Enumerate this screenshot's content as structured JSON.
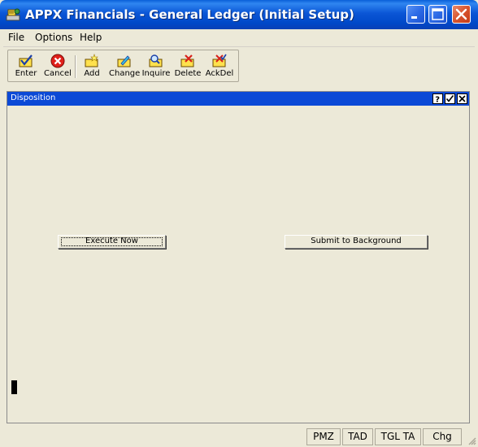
{
  "window": {
    "title": "APPX Financials - General Ledger (Initial Setup)",
    "icon": "appx-app-icon"
  },
  "menu": {
    "items": [
      {
        "label": "File"
      },
      {
        "label": "Options"
      },
      {
        "label": "Help"
      }
    ]
  },
  "toolbar": {
    "buttons": [
      {
        "label": "Enter",
        "icon": "enter-icon"
      },
      {
        "label": "Cancel",
        "icon": "cancel-icon"
      },
      {
        "label": "Add",
        "icon": "add-icon"
      },
      {
        "label": "Change",
        "icon": "change-icon"
      },
      {
        "label": "Inquire",
        "icon": "inquire-icon"
      },
      {
        "label": "Delete",
        "icon": "delete-icon"
      },
      {
        "label": "AckDel",
        "icon": "ackdel-icon"
      }
    ]
  },
  "pane": {
    "title": "Disposition",
    "header_buttons": [
      "help-icon",
      "check-icon",
      "close-icon"
    ]
  },
  "actions": {
    "execute_now": "Execute Now",
    "submit_background": "Submit to Background"
  },
  "statusbar": {
    "cells": [
      "PMZ",
      "TAD",
      "TGL TA",
      "Chg"
    ]
  },
  "colors": {
    "titlebar": "#0b56d6",
    "pane_header": "#0b49d6",
    "background": "#ece9d8"
  }
}
